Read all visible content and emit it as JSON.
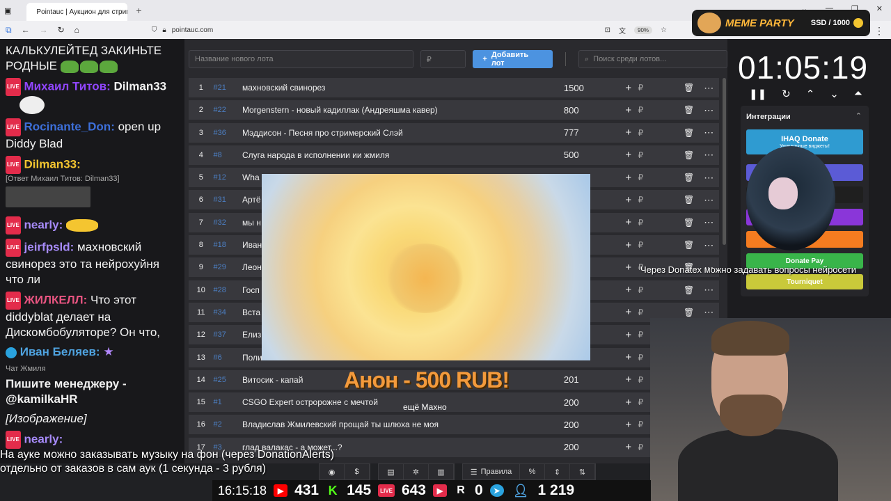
{
  "browser": {
    "tab_title": "Pointauc | Аукцион для стримера",
    "url": "pointauc.com",
    "zoom": "90%"
  },
  "memeparty": {
    "logo": "MEME PARTY",
    "ssd": "SSD / 1000"
  },
  "chat": {
    "messages": [
      {
        "nick": "",
        "text": "КАЛЬКУЛЕЙТЕД ЗАКИНЬТЕ РОДНЫЕ"
      },
      {
        "nick": "Михаил Титов:",
        "text": "Dilman33",
        "color": "#9146ff"
      },
      {
        "nick": "Rocinante_Don:",
        "text": "open up Diddy Blad",
        "color": "#3d6fd9"
      },
      {
        "nick": "Dilman33:",
        "text": "",
        "reply": "[Ответ Михаил Титов: Dilman33]",
        "color": "#f4c530"
      },
      {
        "nick": "nearly:",
        "text": "",
        "color": "#a78bfa"
      },
      {
        "nick": "jeirfpsld:",
        "text": "махновский свинорез это та нейрохуйня что ли",
        "color": "#a78bfa"
      },
      {
        "nick": "ЖИЛКЕЛЛ:",
        "text": "Что этот diddyblat  делает на Дискомбобуляторе? Он что,",
        "color": "#e75480"
      },
      {
        "nick": "Иван Беляев:",
        "text": "",
        "color": "#4fa3e0"
      },
      {
        "nick": "",
        "text": "Пишите менеджеру - @kamilkaHR",
        "source": "Чат Жмиля"
      },
      {
        "nick": "",
        "text": "[Изображение]"
      },
      {
        "nick": "nearly:",
        "text": "",
        "color": "#a78bfa"
      }
    ]
  },
  "inputs": {
    "lot_placeholder": "Название нового лота",
    "amount_placeholder": "₽",
    "add_lot": "Добавить лот",
    "search_placeholder": "Поиск среди лотов..."
  },
  "lots": [
    {
      "n": "1",
      "id": "#21",
      "name": "махновский свинорез",
      "amount": "1500"
    },
    {
      "n": "2",
      "id": "#22",
      "name": "Morgenstern - новый кадиллак (Андреяшма кавер)",
      "amount": "800"
    },
    {
      "n": "3",
      "id": "#36",
      "name": "Мэддисон - Песня про стримерский Слэй",
      "amount": "777"
    },
    {
      "n": "4",
      "id": "#8",
      "name": "Слуга народа в исполнении ии жмиля",
      "amount": "500"
    },
    {
      "n": "5",
      "id": "#12",
      "name": "Wha",
      "amount": ""
    },
    {
      "n": "6",
      "id": "#31",
      "name": "Артё",
      "amount": ""
    },
    {
      "n": "7",
      "id": "#32",
      "name": "мы н",
      "amount": ""
    },
    {
      "n": "8",
      "id": "#18",
      "name": "Иван",
      "amount": ""
    },
    {
      "n": "9",
      "id": "#29",
      "name": "Леон",
      "amount": ""
    },
    {
      "n": "10",
      "id": "#28",
      "name": "Госп",
      "amount": ""
    },
    {
      "n": "11",
      "id": "#34",
      "name": "Вста",
      "amount": ""
    },
    {
      "n": "12",
      "id": "#37",
      "name": "Елиз",
      "amount": ""
    },
    {
      "n": "13",
      "id": "#6",
      "name": "Поли",
      "amount": ""
    },
    {
      "n": "14",
      "id": "#25",
      "name": "Витосик - капай",
      "amount": "201"
    },
    {
      "n": "15",
      "id": "#1",
      "name": "CSGO Expert остророжне с мечтой",
      "amount": "200"
    },
    {
      "n": "16",
      "id": "#2",
      "name": "Владислав Жмилевский прощай ты шлюха не моя",
      "amount": "200"
    },
    {
      "n": "17",
      "id": "#3",
      "name": "глад валакас - а может...?",
      "amount": "200"
    }
  ],
  "overlay": {
    "donation": "Анон - 500 RUB!",
    "donation_msg": "ещё Махно",
    "donatex_tip": "Через Donatex можно задавать вопросы нейросети",
    "music_line1": "На ауке можно заказывать музыку на фон (через DonationAlerts)",
    "music_line2": "отдельно от заказов в сам аук (1 секунда - 3 рубля)"
  },
  "timer": {
    "value": "01:05:19"
  },
  "integrations": {
    "title": "Интеграции",
    "buttons": [
      {
        "label": "IHAQ Donate",
        "sub": "Уникальные виджеты!",
        "color": "#2f9bd1"
      },
      {
        "label": "er",
        "color": "#5b5bd6"
      },
      {
        "label": "",
        "color": "#1f1f1f"
      },
      {
        "label": "",
        "color": "#8a36d9"
      },
      {
        "label": "Alerts",
        "color": "#f57c20"
      },
      {
        "label": "Donate Pay",
        "color": "#39b54a"
      },
      {
        "label": "Tourniquet",
        "color": "#c9c93a"
      }
    ]
  },
  "toolbar": {
    "rules": "Правила",
    "percent": "%"
  },
  "status": {
    "time": "16:15:18",
    "youtube": "431",
    "kick": "145",
    "vk": "643",
    "r": "0",
    "viewers": "1 219"
  }
}
